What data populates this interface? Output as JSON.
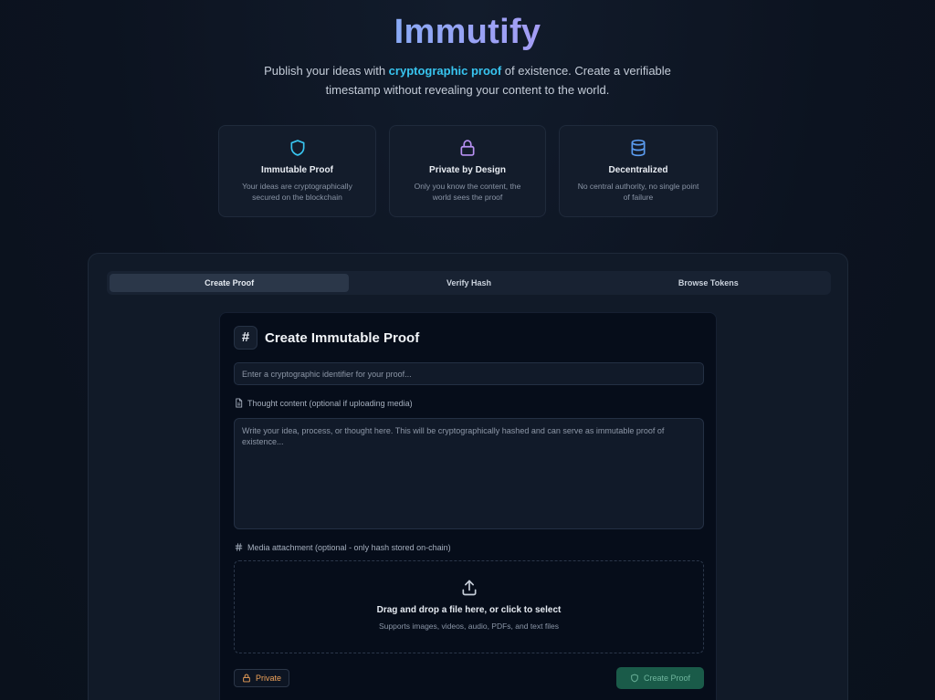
{
  "brand": {
    "name": "Immutify"
  },
  "tagline": {
    "part1": "Publish your ideas with ",
    "highlight": "cryptographic proof",
    "part2": " of existence. Create a verifiable timestamp without revealing your content to the world."
  },
  "features": [
    {
      "icon": "shield-icon",
      "title": "Immutable Proof",
      "desc": "Your ideas are cryptographically secured on the blockchain"
    },
    {
      "icon": "lock-icon",
      "title": "Private by Design",
      "desc": "Only you know the content, the world sees the proof"
    },
    {
      "icon": "database-icon",
      "title": "Decentralized",
      "desc": "No central authority, no single point of failure"
    }
  ],
  "tabs": [
    {
      "label": "Create Proof",
      "active": true
    },
    {
      "label": "Verify Hash",
      "active": false
    },
    {
      "label": "Browse Tokens",
      "active": false
    }
  ],
  "form": {
    "title": "Create Immutable Proof",
    "hash_symbol": "#",
    "identifier_placeholder": "Enter a cryptographic identifier for your proof...",
    "identifier_value": "",
    "thought_label": "Thought content (optional if uploading media)",
    "thought_placeholder": "Write your idea, process, or thought here. This will be cryptographically hashed and can serve as immutable proof of existence...",
    "media_label": "Media attachment (optional - only hash stored on-chain)",
    "dropzone_title": "Drag and drop a file here, or click to select",
    "dropzone_subtitle": "Supports images, videos, audio, PDFs, and text files",
    "private_label": "Private",
    "submit_label": "Create Proof"
  },
  "colors": {
    "accent_cyan": "#38c5f0",
    "accent_purple": "#b891f2",
    "accent_blue": "#5b9cf0",
    "private_orange": "#f0a35a",
    "submit_green": "#1a5b49"
  }
}
